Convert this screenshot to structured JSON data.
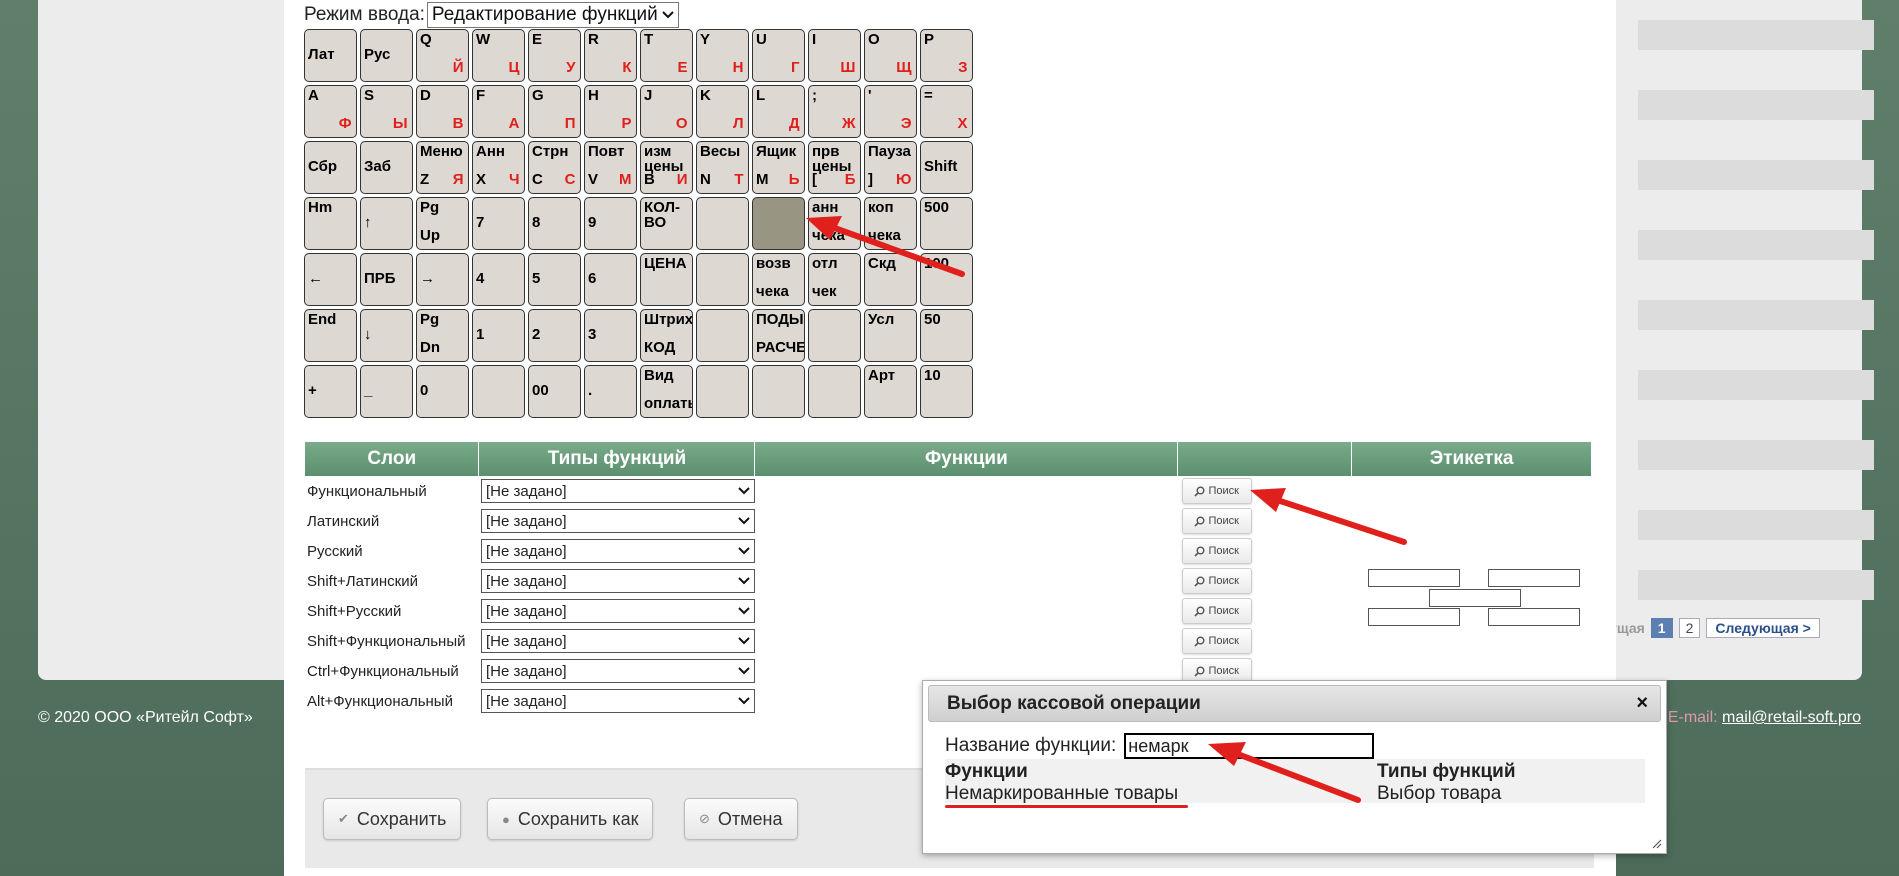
{
  "footer": {
    "copyright": "© 2020 ООО «Ритейл Софт»",
    "email_label": "E-mail:",
    "email": "mail@retail-soft.pro"
  },
  "pager": {
    "prev": "дущая",
    "pages": [
      "1",
      "2"
    ],
    "active_page": "1",
    "next": "Следующая >"
  },
  "mode": {
    "label": "Режим ввода:",
    "value": "Редактирование функций"
  },
  "keyboard": {
    "rows": [
      [
        {
          "l1": "Лат"
        },
        {
          "l1": "Рус"
        },
        {
          "top": "Q",
          "ru": "Й"
        },
        {
          "top": "W",
          "ru": "Ц"
        },
        {
          "top": "E",
          "ru": "У"
        },
        {
          "top": "R",
          "ru": "К"
        },
        {
          "top": "T",
          "ru": "Е"
        },
        {
          "top": "Y",
          "ru": "Н"
        },
        {
          "top": "U",
          "ru": "Г"
        },
        {
          "top": "I",
          "ru": "Ш"
        },
        {
          "top": "O",
          "ru": "Щ"
        },
        {
          "top": "P",
          "ru": "З"
        }
      ],
      [
        {
          "top": "A",
          "ru": "Ф"
        },
        {
          "top": "S",
          "ru": "Ы"
        },
        {
          "top": "D",
          "ru": "В"
        },
        {
          "top": "F",
          "ru": "А"
        },
        {
          "top": "G",
          "ru": "П"
        },
        {
          "top": "H",
          "ru": "Р"
        },
        {
          "top": "J",
          "ru": "О"
        },
        {
          "top": "K",
          "ru": "Л"
        },
        {
          "top": "L",
          "ru": "Д"
        },
        {
          "top": ";",
          "ru": "Ж"
        },
        {
          "top": "'",
          "ru": "Э"
        },
        {
          "top": "=",
          "ru": "Х"
        }
      ],
      [
        {
          "l1": "Сбр"
        },
        {
          "l1": "Заб"
        },
        {
          "top": "Меню",
          "bot": "Z",
          "ru": "Я"
        },
        {
          "top": "Анн",
          "bot": "X",
          "ru": "Ч"
        },
        {
          "top": "Стрн",
          "bot": "C",
          "ru": "С"
        },
        {
          "top": "Повт",
          "bot": "V",
          "ru": "М"
        },
        {
          "top": "изм",
          "mid": "цены",
          "bot": "B",
          "ru": "И"
        },
        {
          "top": "Весы",
          "bot": "N",
          "ru": "Т"
        },
        {
          "top": "Ящик",
          "bot": "M",
          "ru": "Ь"
        },
        {
          "top": "прв",
          "mid": "цены",
          "bot": "[",
          "ru": "Б"
        },
        {
          "top": "Пауза",
          "bot": "]",
          "ru": "Ю"
        },
        {
          "l1": "Shift"
        }
      ],
      [
        {
          "top": "Hm"
        },
        {
          "l1": "↑"
        },
        {
          "top": "Pg",
          "bot": "Up"
        },
        {
          "l1": "7"
        },
        {
          "l1": "8"
        },
        {
          "l1": "9"
        },
        {
          "top": "КОЛ-",
          "mid": "ВО"
        },
        {},
        {
          "selected": true
        },
        {
          "top": "анн",
          "bot": "чека"
        },
        {
          "top": "коп",
          "bot": "чека"
        },
        {
          "top": "500"
        }
      ],
      [
        {
          "l1": "←"
        },
        {
          "l1": "ПРБ"
        },
        {
          "l1": "→"
        },
        {
          "l1": "4"
        },
        {
          "l1": "5"
        },
        {
          "l1": "6"
        },
        {
          "top": "ЦЕНА"
        },
        {},
        {
          "top": "возв",
          "bot": "чека"
        },
        {
          "top": "отл",
          "bot": "чек"
        },
        {
          "top": "Скд"
        },
        {
          "top": "100"
        }
      ],
      [
        {
          "top": "End"
        },
        {
          "l1": "↓"
        },
        {
          "top": "Pg",
          "bot": "Dn"
        },
        {
          "l1": "1"
        },
        {
          "l1": "2"
        },
        {
          "l1": "3"
        },
        {
          "top": "Штрих",
          "bot": "КОД"
        },
        {},
        {
          "top": "ПОДЫ",
          "bot": "РАСЧЕ"
        },
        {},
        {
          "top": "Усл"
        },
        {
          "top": "50"
        }
      ],
      [
        {
          "l1": "+"
        },
        {
          "l1": "_"
        },
        {
          "l1": "0"
        },
        {},
        {
          "l1": "00"
        },
        {
          "l1": "."
        },
        {
          "top": "Вид",
          "bot": "оплаты"
        },
        {},
        {},
        {},
        {
          "top": "Арт"
        },
        {
          "top": "10"
        }
      ]
    ]
  },
  "table": {
    "headers": [
      "Слои",
      "Типы функций",
      "Функции",
      "",
      "Этикетка"
    ],
    "rows": [
      {
        "layer": "Функциональный",
        "type": "[Не задано]",
        "search": "Поиск"
      },
      {
        "layer": "Латинский",
        "type": "[Не задано]",
        "search": "Поиск"
      },
      {
        "layer": "Русский",
        "type": "[Не задано]",
        "search": "Поиск"
      },
      {
        "layer": "Shift+Латинский",
        "type": "[Не задано]",
        "search": "Поиск"
      },
      {
        "layer": "Shift+Русский",
        "type": "[Не задано]",
        "search": "Поиск"
      },
      {
        "layer": "Shift+Функциональный",
        "type": "[Не задано]",
        "search": "Поиск"
      },
      {
        "layer": "Ctrl+Функциональный",
        "type": "[Не задано]",
        "search": "Поиск"
      },
      {
        "layer": "Alt+Функциональный",
        "type": "[Не задано]",
        "search": ""
      }
    ]
  },
  "buttons": {
    "save": "Сохранить",
    "save_as": "Сохранить как",
    "cancel": "Отмена"
  },
  "popup": {
    "title": "Выбор кассовой операции",
    "close": "×",
    "name_label": "Название функции:",
    "name_value": "немарк",
    "col_functions": "Функции",
    "col_types": "Типы функций",
    "result_function": "Немаркированные товары",
    "result_type": "Выбор товара"
  },
  "colors": {
    "accent_green": "#6a9c7c",
    "annotation_red": "#e0201c",
    "key_bg": "#ddd8d2",
    "key_selected": "#999583"
  }
}
